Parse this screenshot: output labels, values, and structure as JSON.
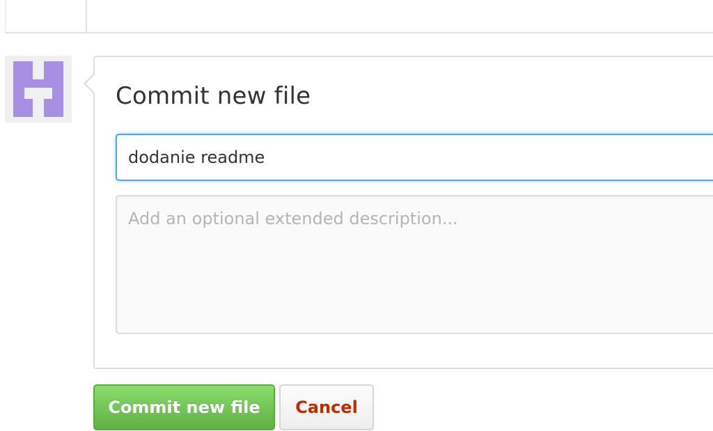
{
  "commit_form": {
    "title": "Commit new file",
    "summary_value": "dodanie readme",
    "description_placeholder": "Add an optional extended description..."
  },
  "buttons": {
    "commit_label": "Commit new file",
    "cancel_label": "Cancel"
  },
  "colors": {
    "avatar_purple": "#a98fe3",
    "commit_green": "#60b044",
    "cancel_red": "#bd2c00",
    "focus_blue": "#51a7e8"
  },
  "icons": {
    "avatar": "identicon-avatar"
  }
}
